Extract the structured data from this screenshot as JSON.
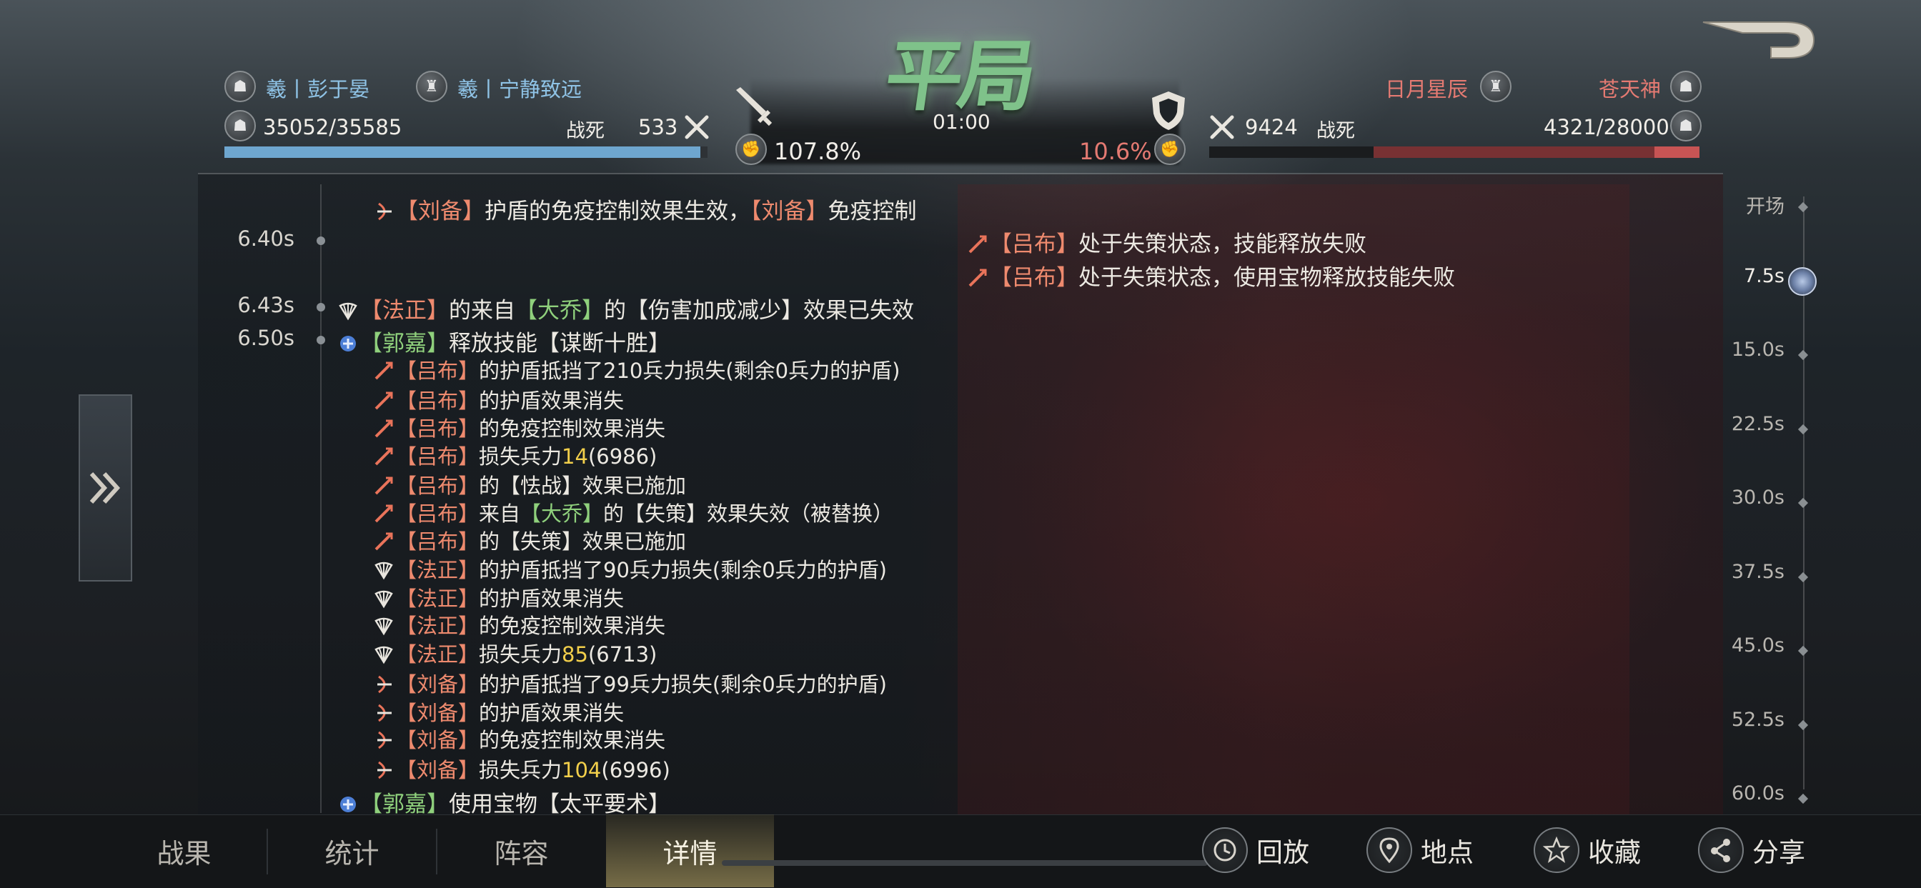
{
  "header": {
    "result_title": "平局",
    "timer": "01:00",
    "left": {
      "player1": "羲丨彭于晏",
      "player2": "羲丨宁静致远",
      "troops": "35052/35585",
      "killed_label": "战死",
      "killed_value": "533",
      "buff_percent": "107.8%",
      "troop_fraction": 0.985
    },
    "right": {
      "player1": "日月星辰",
      "player2": "苍天神",
      "troops": "4321/28000",
      "killed_label": "战死",
      "killed_value": "9424",
      "buff_percent": "10.6%",
      "troop_fraction": 0.154
    }
  },
  "log": [
    {
      "time": "",
      "side": "left",
      "segments": [
        [
          "【刘备】",
          "r"
        ],
        [
          "护盾的免疫控制效果生效，",
          ""
        ],
        [
          "【刘备】",
          "r"
        ],
        [
          "免疫控制",
          ""
        ]
      ],
      "icon": "archer"
    },
    {
      "time": "6.40s",
      "side": "right",
      "segments": [
        [
          "【吕布】",
          "r"
        ],
        [
          "处于失策状态，技能释放失败",
          ""
        ]
      ],
      "icon": "spear"
    },
    {
      "time": "",
      "side": "right",
      "segments": [
        [
          "【吕布】",
          "r"
        ],
        [
          "处于失策状态，使用宝物释放技能失败",
          ""
        ]
      ],
      "icon": "spear"
    },
    {
      "time": "6.43s",
      "side": "left",
      "segments": [
        [
          "【法正】",
          "r"
        ],
        [
          "的来自",
          ""
        ],
        [
          "【大乔】",
          "g"
        ],
        [
          "的【伤害加成减少】效果已失效",
          ""
        ]
      ],
      "icon": "fan"
    },
    {
      "time": "6.50s",
      "side": "left",
      "segments": [
        [
          "【郭嘉】",
          "g"
        ],
        [
          "释放技能【谋断十胜】",
          ""
        ]
      ],
      "icon": "blue"
    },
    {
      "time": "",
      "side": "sub",
      "segments": [
        [
          "【吕布】",
          "r"
        ],
        [
          "的护盾抵挡了210兵力损失(剩余0兵力的护盾)",
          ""
        ]
      ],
      "icon": "spear"
    },
    {
      "time": "",
      "side": "sub",
      "segments": [
        [
          "【吕布】",
          "r"
        ],
        [
          "的护盾效果消失",
          ""
        ]
      ],
      "icon": "spear"
    },
    {
      "time": "",
      "side": "sub",
      "segments": [
        [
          "【吕布】",
          "r"
        ],
        [
          "的免疫控制效果消失",
          ""
        ]
      ],
      "icon": "spear"
    },
    {
      "time": "",
      "side": "sub",
      "segments": [
        [
          "【吕布】",
          "r"
        ],
        [
          "损失兵力",
          ""
        ],
        [
          "14",
          "n"
        ],
        [
          "(6986)",
          ""
        ]
      ],
      "icon": "spear"
    },
    {
      "time": "",
      "side": "sub",
      "segments": [
        [
          "【吕布】",
          "r"
        ],
        [
          "的【怯战】效果已施加",
          ""
        ]
      ],
      "icon": "spear"
    },
    {
      "time": "",
      "side": "sub",
      "segments": [
        [
          "【吕布】",
          "r"
        ],
        [
          "来自",
          ""
        ],
        [
          "【大乔】",
          "g"
        ],
        [
          "的【失策】效果失效（被替换）",
          ""
        ]
      ],
      "icon": "spear"
    },
    {
      "time": "",
      "side": "sub",
      "segments": [
        [
          "【吕布】",
          "r"
        ],
        [
          "的【失策】效果已施加",
          ""
        ]
      ],
      "icon": "spear"
    },
    {
      "time": "",
      "side": "sub",
      "segments": [
        [
          "【法正】",
          "r"
        ],
        [
          "的护盾抵挡了90兵力损失(剩余0兵力的护盾)",
          ""
        ]
      ],
      "icon": "fan"
    },
    {
      "time": "",
      "side": "sub",
      "segments": [
        [
          "【法正】",
          "r"
        ],
        [
          "的护盾效果消失",
          ""
        ]
      ],
      "icon": "fan"
    },
    {
      "time": "",
      "side": "sub",
      "segments": [
        [
          "【法正】",
          "r"
        ],
        [
          "的免疫控制效果消失",
          ""
        ]
      ],
      "icon": "fan"
    },
    {
      "time": "",
      "side": "sub",
      "segments": [
        [
          "【法正】",
          "r"
        ],
        [
          "损失兵力",
          ""
        ],
        [
          "85",
          "n"
        ],
        [
          "(6713)",
          ""
        ]
      ],
      "icon": "fan"
    },
    {
      "time": "",
      "side": "sub",
      "segments": [
        [
          "【刘备】",
          "r"
        ],
        [
          "的护盾抵挡了99兵力损失(剩余0兵力的护盾)",
          ""
        ]
      ],
      "icon": "archer"
    },
    {
      "time": "",
      "side": "sub",
      "segments": [
        [
          "【刘备】",
          "r"
        ],
        [
          "的护盾效果消失",
          ""
        ]
      ],
      "icon": "archer"
    },
    {
      "time": "",
      "side": "sub",
      "segments": [
        [
          "【刘备】",
          "r"
        ],
        [
          "的免疫控制效果消失",
          ""
        ]
      ],
      "icon": "archer"
    },
    {
      "time": "",
      "side": "sub",
      "segments": [
        [
          "【刘备】",
          "r"
        ],
        [
          "损失兵力",
          ""
        ],
        [
          "104",
          "n"
        ],
        [
          "(6996)",
          ""
        ]
      ],
      "icon": "archer"
    },
    {
      "time": "",
      "side": "left",
      "segments": [
        [
          "【郭嘉】",
          "g"
        ],
        [
          "使用宝物【太平要术】",
          ""
        ]
      ],
      "icon": "blue"
    }
  ],
  "timeline_scale": [
    "开场",
    "7.5s",
    "15.0s",
    "22.5s",
    "30.0s",
    "37.5s",
    "45.0s",
    "52.5s",
    "60.0s"
  ],
  "timeline_active_index": 1,
  "tabs": [
    "战果",
    "统计",
    "阵容",
    "详情"
  ],
  "active_tab": 3,
  "actions": [
    {
      "label": "回放",
      "icon": "replay-icon"
    },
    {
      "label": "地点",
      "icon": "location-pin-icon"
    },
    {
      "label": "收藏",
      "icon": "star-icon"
    },
    {
      "label": "分享",
      "icon": "share-icon"
    }
  ],
  "colors": {
    "left_bar": "#6ea6cf",
    "right_bar": "#c75454",
    "name_red": "#ee8a6e",
    "name_green": "#8fd07c",
    "number": "#f2cf4b",
    "title": "#7fc28a"
  }
}
